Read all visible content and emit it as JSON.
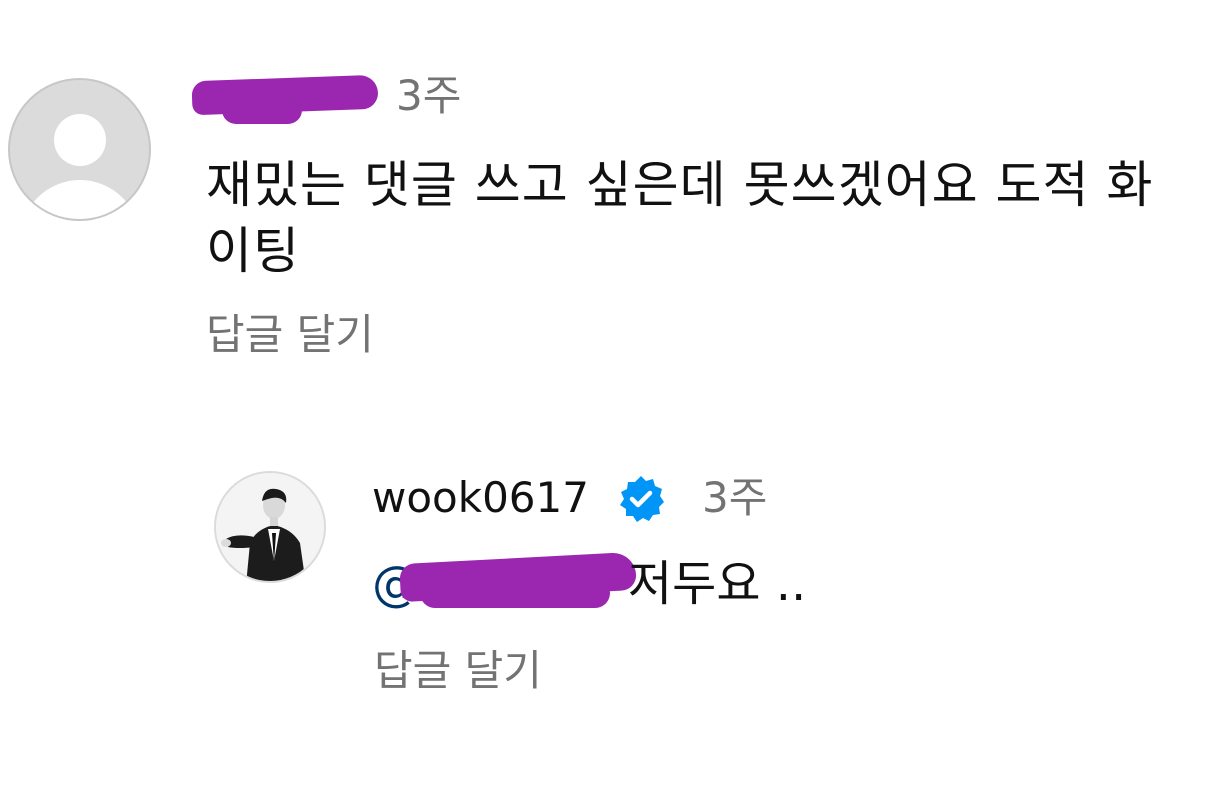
{
  "comment": {
    "username": "",
    "username_redacted": true,
    "time": "3주",
    "text": "재밌는 댓글 쓰고 싶은데 못쓰겠어요 도적 화이팅",
    "reply_label": "답글 달기"
  },
  "reply": {
    "username": "wook0617",
    "verified": true,
    "time": "3주",
    "mention": "@",
    "mention_redacted": true,
    "text": "저두요 ..",
    "reply_label": "답글 달기"
  },
  "colors": {
    "primary_text": "#111111",
    "secondary_text": "#737373",
    "mention": "#00376b",
    "verified_badge": "#0095f6",
    "redaction": "#9b27b0"
  },
  "icons": {
    "default_avatar": "default-profile-icon",
    "verified": "verified-badge-icon"
  }
}
